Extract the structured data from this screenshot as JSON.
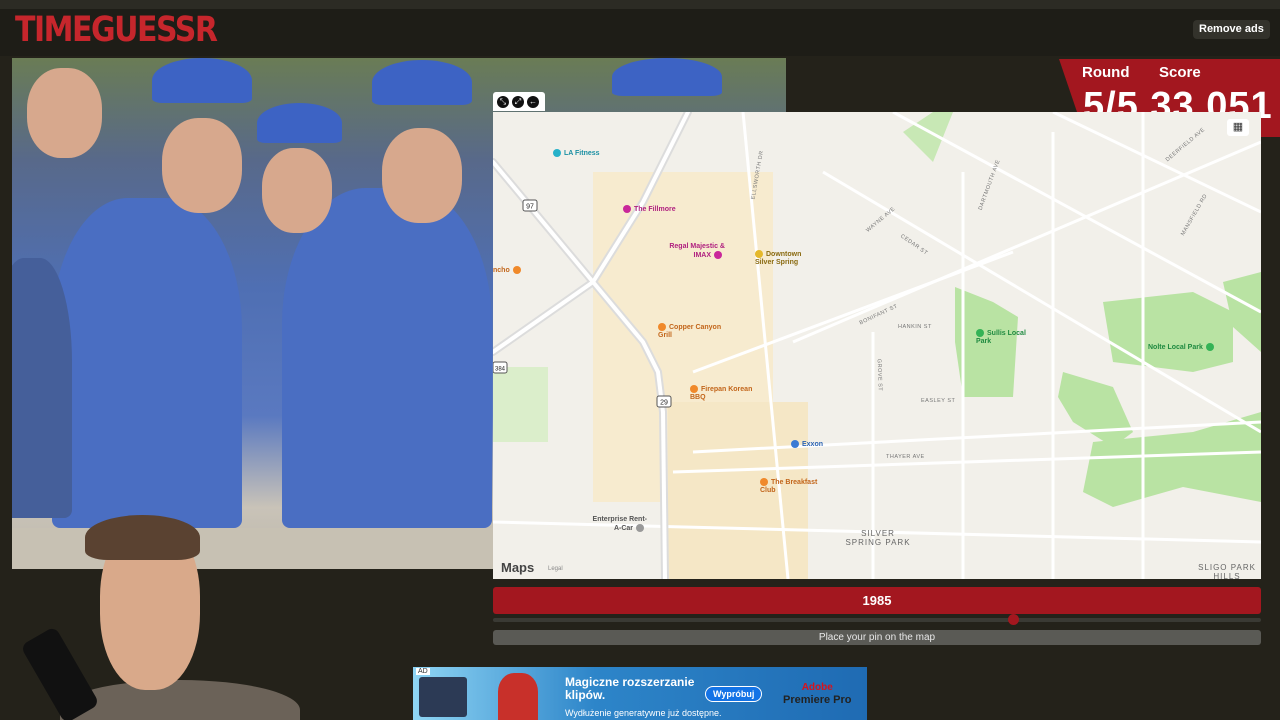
{
  "app": {
    "logo": "TIMEGUESSR",
    "remove_ads_label": "Remove ads"
  },
  "score_panel": {
    "round_label": "Round",
    "score_label": "Score",
    "round_value": "5/5",
    "score_value": "33,051"
  },
  "map": {
    "brand": "Maps",
    "legal": "Legal",
    "pois": [
      {
        "name": "LA Fitness",
        "color": "#27b1c9"
      },
      {
        "name": "The Fillmore",
        "color": "#c9279a"
      },
      {
        "name": "Regal Majestic & IMAX",
        "color": "#c9279a"
      },
      {
        "name": "Downtown Silver Spring",
        "color": "#e5b82a"
      },
      {
        "name": "Copper Canyon Grill",
        "color": "#f0892a"
      },
      {
        "name": "Firepan Korean BBQ",
        "color": "#f0892a"
      },
      {
        "name": "Exxon",
        "color": "#3b7bd4"
      },
      {
        "name": "The Breakfast Club",
        "color": "#f0892a"
      },
      {
        "name": "Enterprise Rent-A-Car",
        "color": "#999999"
      },
      {
        "name": "Sullis Local Park",
        "color": "#34b356"
      },
      {
        "name": "Nolte Local Park",
        "color": "#34b356"
      },
      {
        "name": "ncho",
        "color": "#f0892a"
      }
    ],
    "streets": [
      "ELLSWORTH DR",
      "WAYNE AVE",
      "CEDAR ST",
      "DARTMOUTH AVE",
      "DEERFIELD AVE",
      "MANSFIELD RD",
      "BONIFANT ST",
      "HANKIN ST",
      "GROVE ST",
      "EASLEY ST",
      "THAYER AVE"
    ],
    "route_shields": [
      "97",
      "29",
      "384"
    ],
    "areas": [
      "SILVER SPRING PARK",
      "SLIGO PARK HILLS"
    ]
  },
  "controls": {
    "year_label": "1985",
    "year_fraction": 0.678,
    "pin_prompt": "Place your pin on the map"
  },
  "ad": {
    "tag": "AD",
    "title": "Magiczne rozszerzanie klipów.",
    "subtitle": "Wydłużenie generatywne już dostępne.",
    "cta": "Wypróbuj",
    "brand_top": "Adobe",
    "brand_bottom": "Premiere Pro"
  },
  "colors": {
    "brand_red": "#a3171f",
    "background": "#24221a"
  }
}
